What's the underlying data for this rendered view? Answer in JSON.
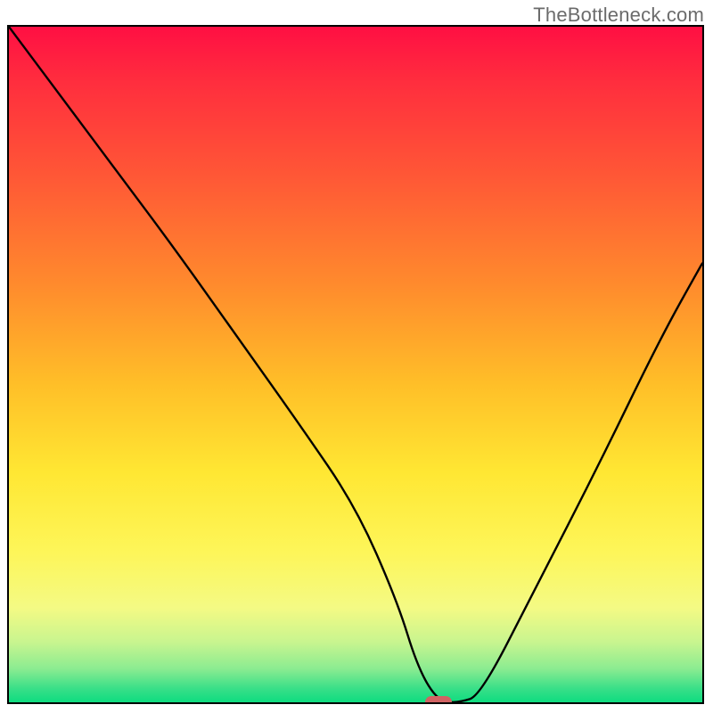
{
  "watermark": {
    "text": "TheBottleneck.com"
  },
  "chart_data": {
    "type": "line",
    "title": "",
    "xlabel": "",
    "ylabel": "",
    "xlim": [
      0,
      100
    ],
    "ylim": [
      0,
      100
    ],
    "series": [
      {
        "name": "bottleneck-curve",
        "x": [
          0,
          8,
          16,
          24,
          33,
          42,
          50,
          56,
          59,
          62,
          65,
          68,
          76,
          85,
          94,
          100
        ],
        "values": [
          100,
          89,
          78,
          67,
          54,
          41,
          29,
          15,
          5,
          0,
          0,
          1,
          17,
          35,
          54,
          65
        ]
      }
    ],
    "marker": {
      "x": 62,
      "y": 0,
      "color": "#d16363"
    },
    "background_gradient": {
      "stops": [
        {
          "pct": 0,
          "color": "#ff0f43"
        },
        {
          "pct": 50,
          "color": "#ffe733"
        },
        {
          "pct": 100,
          "color": "#0edc80"
        }
      ]
    }
  }
}
